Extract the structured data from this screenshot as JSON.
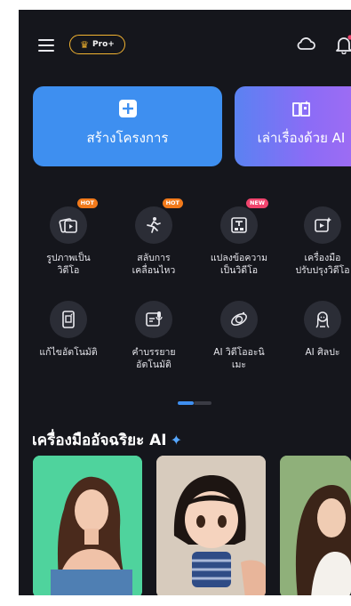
{
  "header": {
    "pro_label": "Pro+"
  },
  "cards": {
    "create_label": "สร้างโครงการ",
    "story_label": "เล่าเรื่องด้วย AI"
  },
  "tools": [
    {
      "label": "รูปภาพเป็น\nวิดีโอ",
      "badge": "HOT",
      "icon": "image-to-video-icon"
    },
    {
      "label": "สลับการ\nเคลื่อนไหว",
      "badge": "HOT",
      "icon": "motion-swap-icon"
    },
    {
      "label": "แปลงข้อความ\nเป็นวิดีโอ",
      "badge": "NEW",
      "icon": "text-to-video-icon"
    },
    {
      "label": "เครื่องมือ\nปรับปรุงวิดีโอ",
      "badge": "",
      "icon": "video-enhance-icon"
    },
    {
      "label": "แก้ไขอัตโนมัติ",
      "badge": "",
      "icon": "auto-edit-icon"
    },
    {
      "label": "คำบรรยาย\nอัตโนมัติ",
      "badge": "",
      "icon": "auto-caption-icon"
    },
    {
      "label": "AI วิดีโออะนิ\nเมะ",
      "badge": "",
      "icon": "ai-anime-icon"
    },
    {
      "label": "AI ศิลปะ",
      "badge": "",
      "icon": "ai-art-icon"
    }
  ],
  "section": {
    "title": "เครื่องมืออัจฉริยะ AI"
  },
  "colors": {
    "background": "#15161c",
    "accent_blue": "#3e8ff0",
    "pro_gold": "#f2b331",
    "hot": "#f27a1b",
    "new": "#f0446d"
  }
}
